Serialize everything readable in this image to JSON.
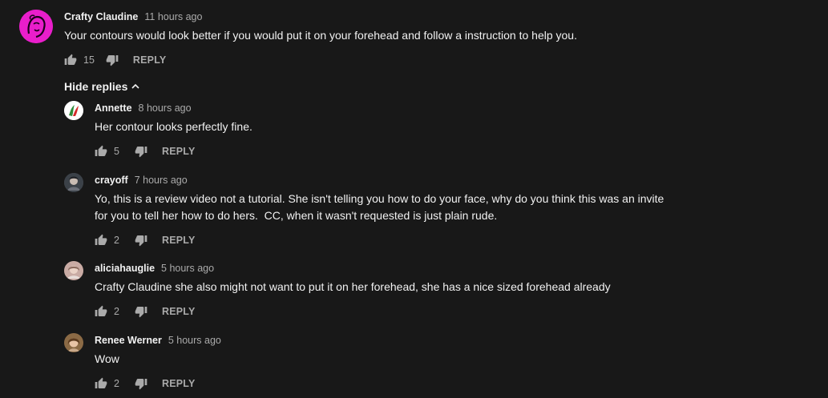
{
  "top_comment": {
    "author": "Crafty Claudine",
    "time": "11 hours ago",
    "text": "Your contours would look better if you would put it on your forehead and follow a instruction to help you.",
    "likes": "15",
    "reply_label": "REPLY",
    "avatar_color": "#e91ecb"
  },
  "hide_replies_label": "Hide replies",
  "replies": [
    {
      "author": "Annette",
      "time": "8 hours ago",
      "text": "Her contour looks perfectly fine.",
      "likes": "5",
      "reply_label": "REPLY"
    },
    {
      "author": "crayoff",
      "time": "7 hours ago",
      "text": "Yo, this is a review video not a tutorial. She isn't telling you how to do your face, why do you think this was an invite for you to tell her how to do hers.  CC, when it wasn't requested is just plain rude.",
      "likes": "2",
      "reply_label": "REPLY"
    },
    {
      "author": "aliciahauglie",
      "time": "5 hours ago",
      "text": "Crafty Claudine she also might not want to put it on her forehead, she has a nice sized forehead already",
      "likes": "2",
      "reply_label": "REPLY"
    },
    {
      "author": "Renee Werner",
      "time": "5 hours ago",
      "text": "Wow",
      "likes": "2",
      "reply_label": "REPLY"
    }
  ],
  "colors": {
    "background": "#181818",
    "text_primary": "#f1f1f1",
    "text_secondary": "#aaaaaa"
  }
}
